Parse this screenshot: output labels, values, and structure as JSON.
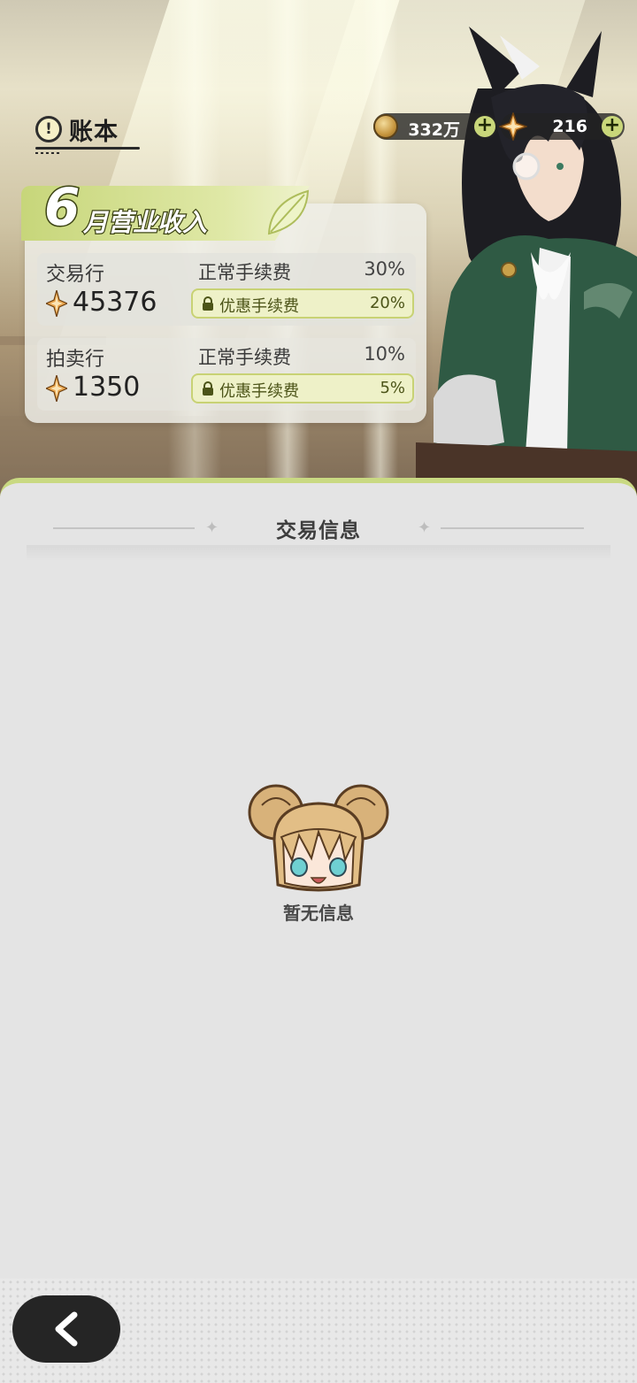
{
  "header": {
    "title": "账本",
    "icon": "alert-circle-icon"
  },
  "currencies": [
    {
      "name": "coin",
      "icon": "gold-coin-icon",
      "value": "332万"
    },
    {
      "name": "star-crystal",
      "icon": "star-crystal-icon",
      "value": "216"
    }
  ],
  "income_card": {
    "month": "6",
    "title": "月营业收入",
    "rows": [
      {
        "name": "交易行",
        "amount": "45376",
        "normal_label": "正常手续费",
        "normal_pct": "30%",
        "discount_label": "优惠手续费",
        "discount_pct": "20%"
      },
      {
        "name": "拍卖行",
        "amount": "1350",
        "normal_label": "正常手续费",
        "normal_pct": "10%",
        "discount_label": "优惠手续费",
        "discount_pct": "5%"
      }
    ]
  },
  "panel": {
    "title": "交易信息",
    "empty_text": "暂无信息"
  },
  "colors": {
    "accent": "#c9d982",
    "dark": "#252525",
    "panel_bg": "#e4e4e4"
  }
}
